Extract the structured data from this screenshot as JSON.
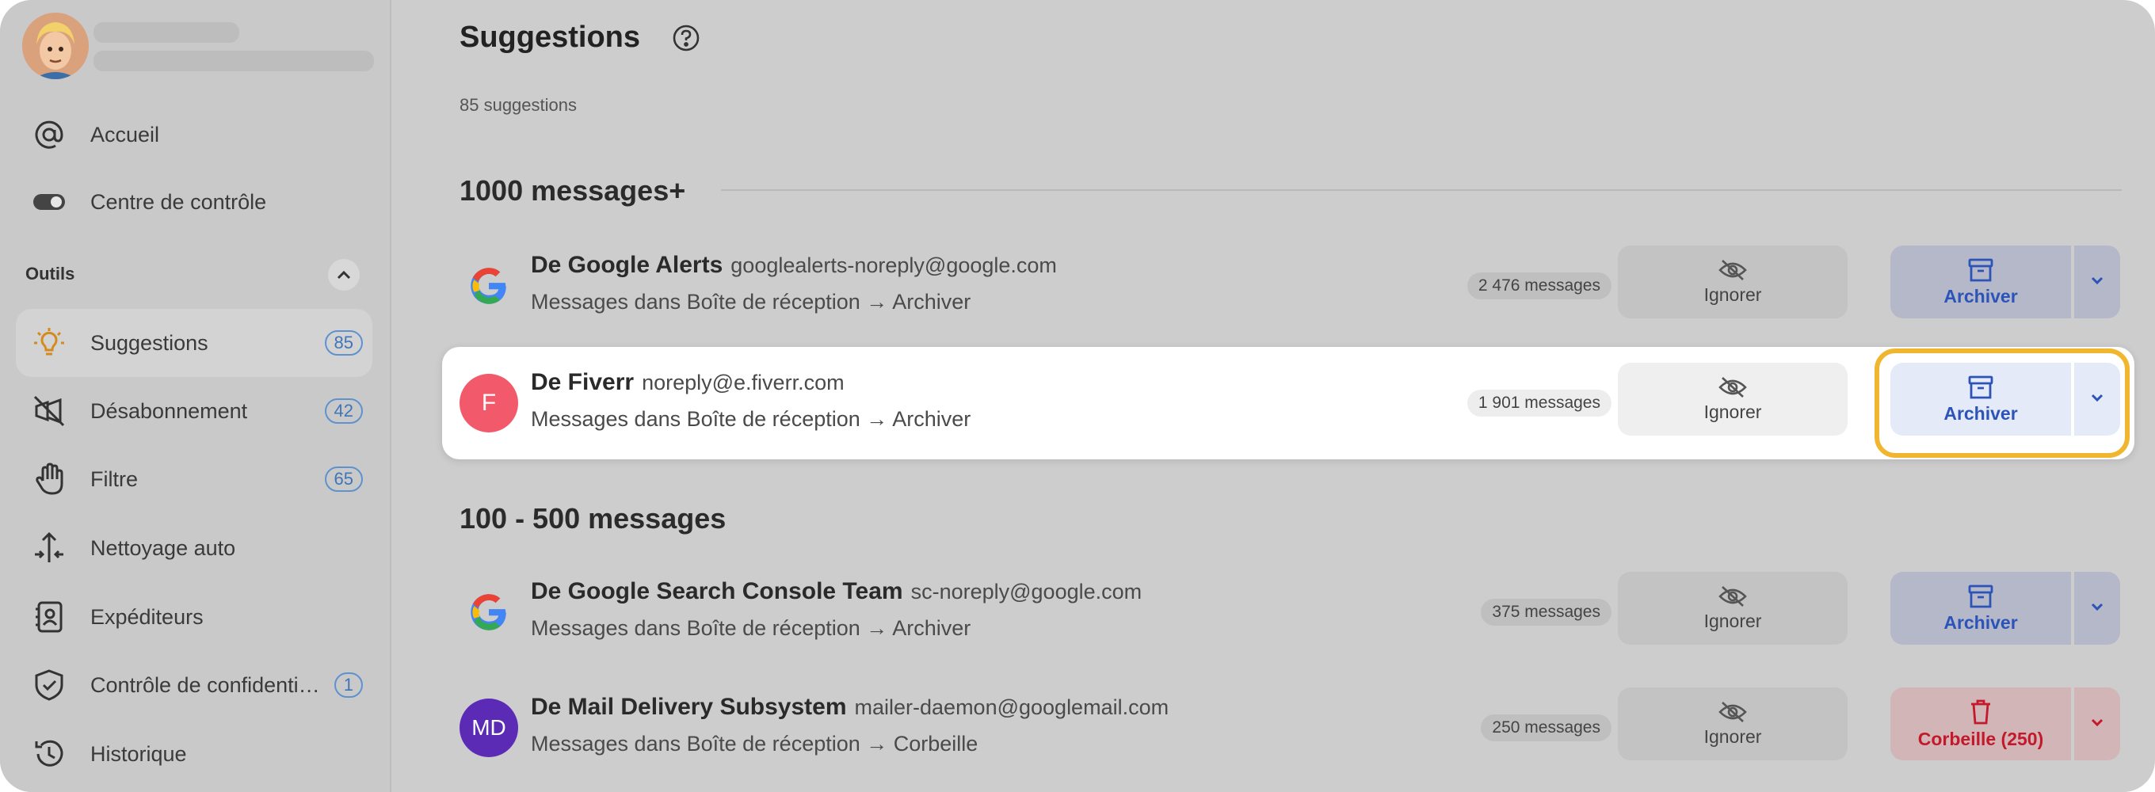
{
  "sidebar": {
    "items": [
      {
        "label": "Accueil",
        "icon": "at-sign-icon"
      },
      {
        "label": "Centre de contrôle",
        "icon": "toggle-icon"
      },
      {
        "label": "Suggestions",
        "icon": "lightbulb-icon",
        "badge": "85"
      },
      {
        "label": "Désabonnement",
        "icon": "unsubscribe-icon",
        "badge": "42"
      },
      {
        "label": "Filtre",
        "icon": "hand-icon",
        "badge": "65"
      },
      {
        "label": "Nettoyage auto",
        "icon": "arrows-icon"
      },
      {
        "label": "Expéditeurs",
        "icon": "contacts-icon"
      },
      {
        "label": "Contrôle de confidenti…",
        "icon": "shield-icon",
        "badge": "1"
      },
      {
        "label": "Historique",
        "icon": "clock-icon"
      }
    ],
    "section_title": "Outils"
  },
  "main": {
    "title": "Suggestions",
    "count": "85 suggestions",
    "groups": [
      {
        "title": "1000 messages+"
      },
      {
        "title": "100 - 500 messages"
      }
    ],
    "rows": [
      {
        "name": "De Google Alerts",
        "email": "googlealerts-noreply@google.com",
        "sub": "Messages dans Boîte de réception → Archiver",
        "count": "2 476 messages",
        "ignore": "Ignorer",
        "action": "Archiver"
      },
      {
        "name": "De Fiverr",
        "email": "noreply@e.fiverr.com",
        "sub": "Messages dans Boîte de réception → Archiver",
        "count": "1 901 messages",
        "ignore": "Ignorer",
        "action": "Archiver",
        "initial": "F"
      },
      {
        "name": "De Google Search Console Team",
        "email": "sc-noreply@google.com",
        "sub": "Messages dans Boîte de réception → Archiver",
        "count": "375 messages",
        "ignore": "Ignorer",
        "action": "Archiver"
      },
      {
        "name": "De Mail Delivery Subsystem",
        "email": "mailer-daemon@googlemail.com",
        "sub": "Messages dans Boîte de réception → Corbeille",
        "count": "250 messages",
        "ignore": "Ignorer",
        "action": "Corbeille (250)",
        "initial": "MD"
      }
    ]
  },
  "colors": {
    "accent": "#2c54b8",
    "danger": "#c4182b",
    "focus": "#f1b62f",
    "fiverr": "#f2596a",
    "md": "#5b2bb6"
  }
}
